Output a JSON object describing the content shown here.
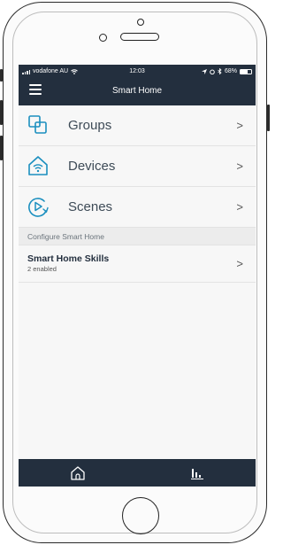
{
  "status_bar": {
    "carrier": "vodafone AU",
    "time": "12:03",
    "battery": "68%",
    "battery_level": 0.68
  },
  "header": {
    "title": "Smart Home"
  },
  "menu": {
    "items": [
      {
        "label": "Groups",
        "icon": "groups-icon"
      },
      {
        "label": "Devices",
        "icon": "devices-icon"
      },
      {
        "label": "Scenes",
        "icon": "scenes-icon"
      }
    ],
    "chevron": ">"
  },
  "configure": {
    "section_title": "Configure Smart Home",
    "skills_title": "Smart Home Skills",
    "skills_subtitle": "2 enabled"
  },
  "tabbar": {
    "tabs": [
      {
        "icon": "home-icon"
      },
      {
        "icon": "activity-icon"
      }
    ]
  },
  "colors": {
    "header_bg": "#232f3e",
    "accent": "#1b8fbf",
    "text": "#3e4b57"
  }
}
